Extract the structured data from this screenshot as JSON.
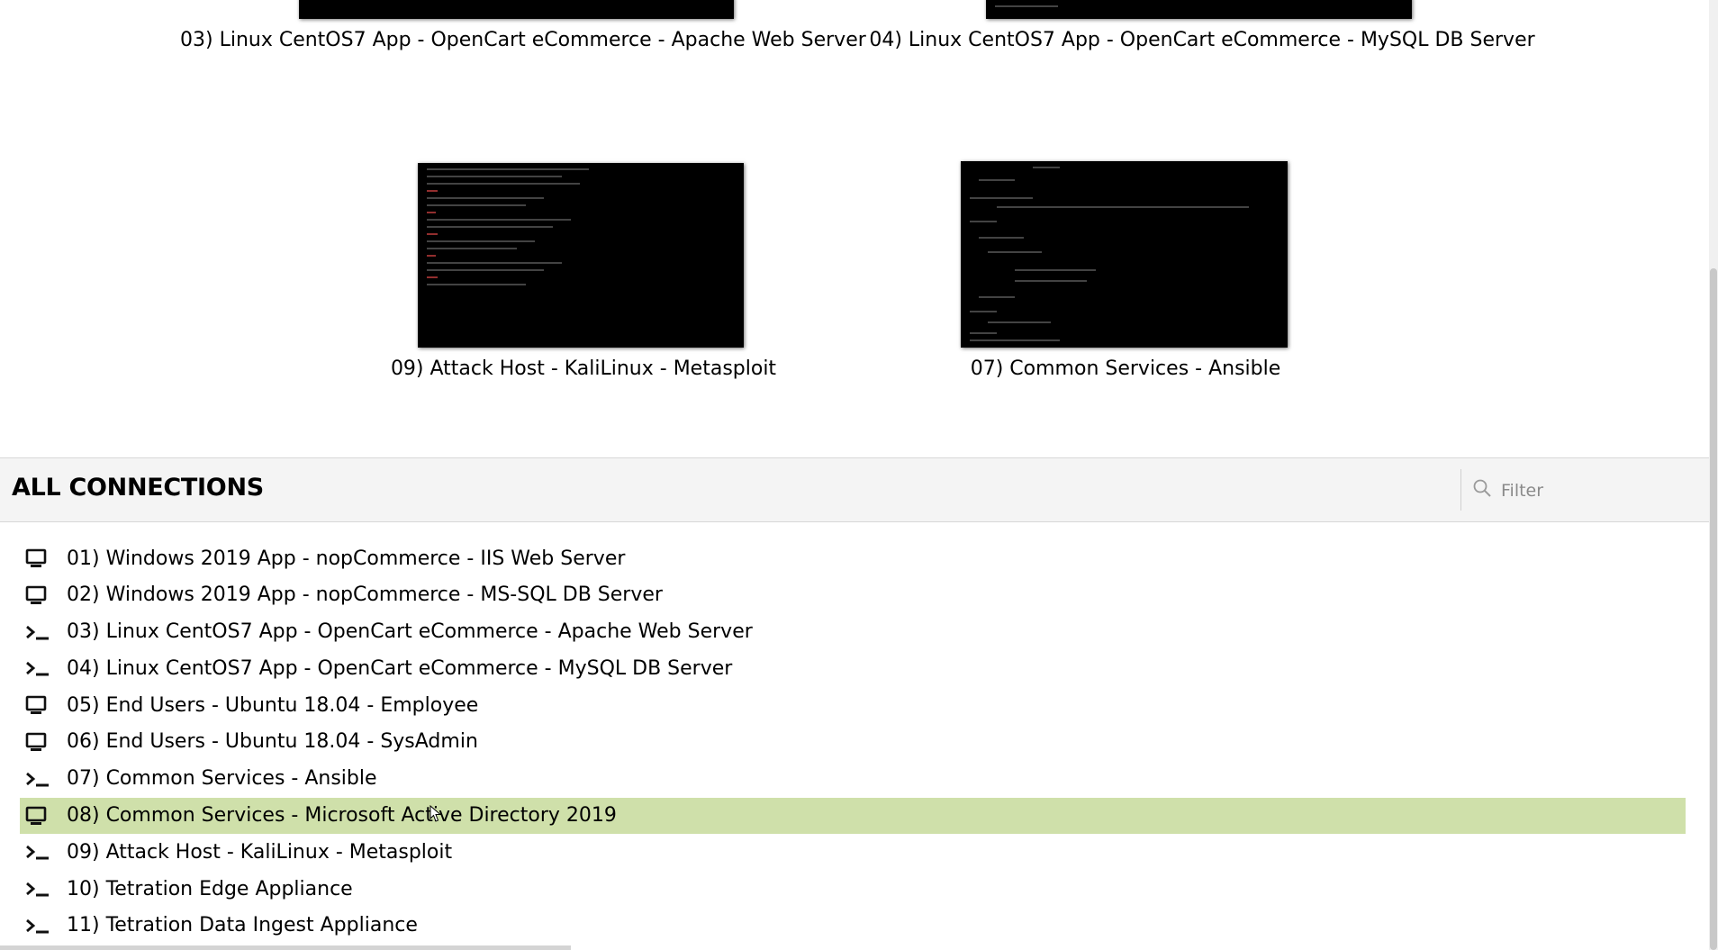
{
  "recent_connections": [
    {
      "label": "03) Linux CentOS7 App - OpenCart eCommerce - Apache Web Server"
    },
    {
      "label": "04) Linux CentOS7 App - OpenCart eCommerce - MySQL DB Server"
    },
    {
      "label": "09) Attack Host - KaliLinux - Metasploit"
    },
    {
      "label": "07) Common Services - Ansible"
    }
  ],
  "all_connections": {
    "title": "ALL CONNECTIONS",
    "filter_placeholder": "Filter",
    "filter_icon": "search-icon",
    "items": [
      {
        "label": "01) Windows 2019 App - nopCommerce - IIS Web Server",
        "icon": "desktop-icon"
      },
      {
        "label": "02) Windows 2019 App - nopCommerce - MS-SQL DB Server",
        "icon": "desktop-icon"
      },
      {
        "label": "03) Linux CentOS7 App - OpenCart eCommerce - Apache Web Server",
        "icon": "terminal-icon"
      },
      {
        "label": "04) Linux CentOS7 App - OpenCart eCommerce - MySQL DB Server",
        "icon": "terminal-icon"
      },
      {
        "label": "05) End Users - Ubuntu 18.04 - Employee",
        "icon": "desktop-icon"
      },
      {
        "label": "06) End Users - Ubuntu 18.04 - SysAdmin",
        "icon": "desktop-icon"
      },
      {
        "label": "07) Common Services - Ansible",
        "icon": "terminal-icon"
      },
      {
        "label": "08) Common Services - Microsoft Active Directory 2019",
        "icon": "desktop-icon",
        "selected": true
      },
      {
        "label": "09) Attack Host - KaliLinux - Metasploit",
        "icon": "terminal-icon"
      },
      {
        "label": "10) Tetration Edge Appliance",
        "icon": "terminal-icon"
      },
      {
        "label": "11) Tetration Data Ingest Appliance",
        "icon": "terminal-icon"
      }
    ]
  },
  "colors": {
    "selected_row": "#cfe0aa",
    "thumbnail_bg": "#000000",
    "section_bg": "#f4f4f4"
  }
}
